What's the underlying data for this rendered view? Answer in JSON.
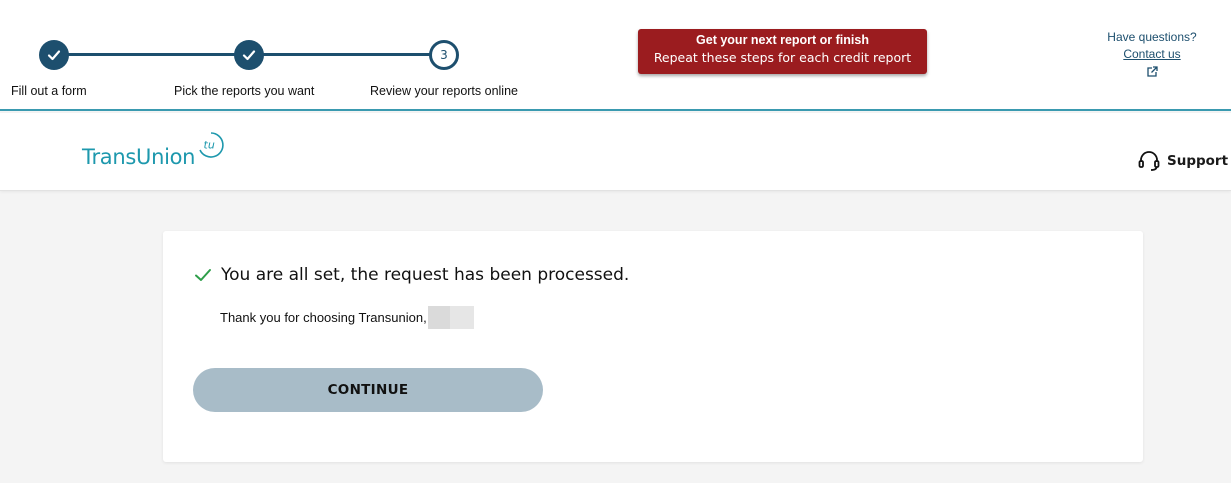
{
  "progress": {
    "steps": [
      {
        "label": "Fill out a form",
        "status": "complete"
      },
      {
        "label": "Pick the reports you want",
        "status": "complete"
      },
      {
        "label": "Review your reports online",
        "status": "current",
        "number": "3"
      }
    ],
    "colors": {
      "track": "#1d4f6e",
      "accent": "#3a9ab0"
    }
  },
  "banner": {
    "title": "Get your next report or finish",
    "subtitle": "Repeat these steps for each credit report",
    "color": "#9b1c1f"
  },
  "help": {
    "question": "Have questions?",
    "link": "Contact us",
    "icon": "external-link-icon"
  },
  "header": {
    "logo_text": "TransUnion",
    "logo_mark": "tu",
    "support_label": "Support",
    "support_icon": "headset-icon",
    "brand_color": "#1d98ad"
  },
  "confirmation": {
    "message": "You are all set, the request has been processed.",
    "thanks": "Thank you for choosing Transunion,",
    "button_label": "CONTINUE",
    "check_color": "#2e9e4a"
  }
}
